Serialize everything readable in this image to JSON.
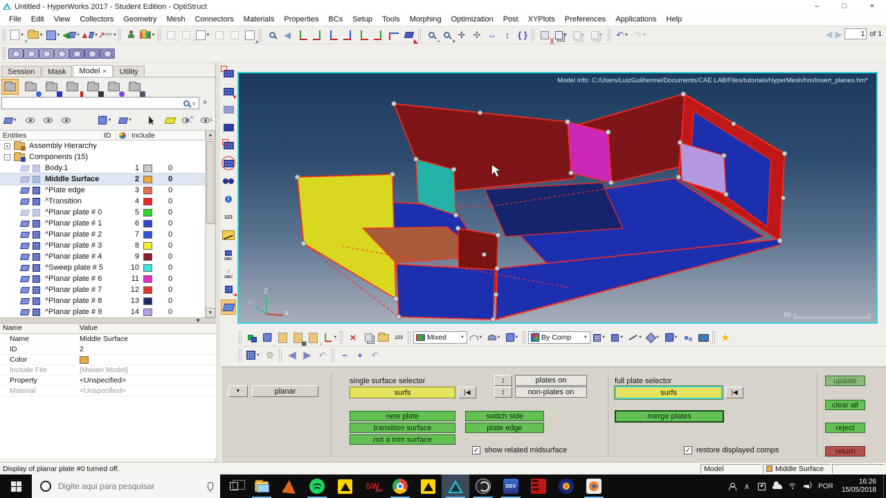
{
  "palette": {
    "accent_orange": "#f2a93b",
    "button_green": "#63c153",
    "button_green_disabled": "#8abb78",
    "button_yellow": "#e6e45e",
    "button_maroon": "#b5514b",
    "selector_active_border": "#35d0e0",
    "viewport_border": "#2cd3dc",
    "taskbar_active": "#3a4a58"
  },
  "icons": {
    "caret": "▼",
    "spinner": "↕",
    "reset": "|◀",
    "check": "✓",
    "chevrons": "»",
    "search_caret": "∨",
    "minimize": "–",
    "maximize": "□",
    "close": "×",
    "star": "★",
    "undo": "↶",
    "redo": "↷",
    "back": "◀",
    "forward": "▶",
    "minus": "−",
    "plus": "+",
    "braces": "{ }",
    "red_x": "×",
    "up_small": "▲",
    "down_small": "▼",
    "numbers": "123",
    "abc": "ABC",
    "hand": "✣",
    "arrows_h": "↔",
    "arrows_v": "↕",
    "dev": "DEV",
    "sw": "SW",
    "sw_year": "2017"
  },
  "title_bar": {
    "title": "Untitled - HyperWorks 2017 - Student Edition - OptiStruct"
  },
  "menu_bar": {
    "items": [
      "File",
      "Edit",
      "View",
      "Collectors",
      "Geometry",
      "Mesh",
      "Connectors",
      "Materials",
      "Properties",
      "BCs",
      "Setup",
      "Tools",
      "Morphing",
      "Optimization",
      "Post",
      "XYPlots",
      "Preferences",
      "Applications",
      "Help"
    ]
  },
  "toolbar": {
    "page_value": "1",
    "page_of_label": "of 1",
    "row1_icons": [
      "new-model",
      "open-model",
      "save-model",
      "import",
      "export",
      "export-ppt",
      "user",
      "results-folder",
      "add-page",
      "delete-page",
      "page-layout",
      "expand-page",
      "swap-page",
      "page-window",
      "zoom-tool",
      "back-view",
      "axis-yx",
      "axis-yx2",
      "axis-zx",
      "axis-zx2",
      "axis-zy",
      "axis-zy2",
      "axis-yz",
      "shaded-view",
      "zoom-out",
      "zoom-in",
      "center",
      "pan",
      "fit-width",
      "fit-height",
      "rotate",
      "cut",
      "copy",
      "paste",
      "paste-special",
      "undo",
      "redo"
    ],
    "row2_icons": [
      "capture-image",
      "capture-window",
      "capture-region",
      "capture-area",
      "capture-video",
      "capture-video-window",
      "capture-video-region"
    ]
  },
  "left_panel": {
    "tabs": [
      {
        "label": "Session"
      },
      {
        "label": "Mask"
      },
      {
        "label": "Model",
        "close": "×"
      },
      {
        "label": "Utility"
      }
    ],
    "browser_icons": [
      "model-view",
      "connection-view",
      "component-view",
      "include-view",
      "part-view",
      "set-view",
      "organize-view"
    ],
    "search_value": "",
    "tree": {
      "header": {
        "entities": "Entities",
        "id": "ID",
        "include": "Include"
      },
      "items": [
        {
          "expander": "+",
          "label": "Assembly Hierarchy"
        },
        {
          "expander": "-",
          "label": "Components (15)"
        },
        {
          "label": "Body.1",
          "id": "1",
          "color": "#c9c9c9",
          "include": "0",
          "dim": true
        },
        {
          "label": "Middle Surface",
          "id": "2",
          "color": "#f2a93b",
          "include": "0",
          "selected": true,
          "dim": true
        },
        {
          "label": "^Plate edge",
          "id": "3",
          "color": "#e2714c",
          "include": "0"
        },
        {
          "label": "^Transition",
          "id": "4",
          "color": "#ee2222",
          "include": "0"
        },
        {
          "label": "^Planar plate # 0",
          "id": "5",
          "color": "#2ad82a",
          "include": "0",
          "dim": true
        },
        {
          "label": "^Planar plate # 1",
          "id": "6",
          "color": "#2945cf",
          "include": "0"
        },
        {
          "label": "^Planar plate # 2",
          "id": "7",
          "color": "#2c55e2",
          "include": "0"
        },
        {
          "label": "^Planar plate # 3",
          "id": "8",
          "color": "#f0ee30",
          "include": "0"
        },
        {
          "label": "^Planar plate # 4",
          "id": "9",
          "color": "#8e1a2a",
          "include": "0"
        },
        {
          "label": "^Sweep plate # 5",
          "id": "10",
          "color": "#38e8e8",
          "include": "0"
        },
        {
          "label": "^Planar plate # 6",
          "id": "11",
          "color": "#e32cc9",
          "include": "0"
        },
        {
          "label": "^Planar plate # 7",
          "id": "12",
          "color": "#da382a",
          "include": "0"
        },
        {
          "label": "^Planar plate # 8",
          "id": "13",
          "color": "#1b2b68",
          "include": "0"
        },
        {
          "label": "^Planar plate # 9",
          "id": "14",
          "color": "#bb9cea",
          "include": "0"
        }
      ]
    },
    "properties": {
      "header": {
        "name": "Name",
        "value": "Value"
      },
      "color_swatch": "#f2a93b",
      "rows": [
        {
          "name": "Name",
          "value": "Middle Surface"
        },
        {
          "name": "ID",
          "value": "2"
        },
        {
          "name": "Color",
          "value": ""
        },
        {
          "name": "Include File",
          "value": "[Master Model]",
          "muted": true
        },
        {
          "name": "Property",
          "value": "<Unspecified>"
        },
        {
          "name": "Material",
          "value": "<Unspecified>",
          "muted": true
        }
      ]
    }
  },
  "vertical_toolbar": {
    "icons": [
      "panel-frame",
      "panel-arrow",
      "panels",
      "panels-dark",
      "panel-frame-2",
      "panel-circle",
      "binoculars-find",
      "info",
      "numbers-display",
      "measure-angle",
      "element-labels",
      "load-labels",
      "reorder-panels",
      "surface-edit-active"
    ]
  },
  "viewport": {
    "model_info": "Model Info: C:/Users/LuizGuilherme/Documents/CAE LAB/Files/tutorials/HyperMesh/hm/Insert_planes.hm*",
    "axis": {
      "x": "X",
      "y": "Y",
      "z": "Z"
    },
    "scale_label": "50"
  },
  "view_toolbar": {
    "mixed_label": "Mixed",
    "by_comp_label": "By Comp",
    "row1_icons": [
      "components",
      "component-blue",
      "card-edit",
      "card-image",
      "load-import",
      "systems",
      "delete",
      "layers",
      "organize",
      "renumber",
      "mixed-mode-dropdown",
      "wireframe",
      "shaded",
      "solid",
      "by-comp-dropdown",
      "mesh-wire",
      "mesh-shaded",
      "line-style",
      "feature",
      "layer-set",
      "checker",
      "monitor",
      "favorites-star"
    ],
    "row2_icons": [
      "grid-panel",
      "wrench-options",
      "previous",
      "next",
      "undo-view",
      "collapse",
      "expand",
      "undo-small"
    ]
  },
  "panel": {
    "mode_label": "planar",
    "single_selector_label": "single surface selector",
    "single_selector_value": "surfs",
    "full_selector_label": "full plate selector",
    "full_selector_value": "surfs",
    "plates_on_label": "plates on",
    "non_plates_on_label": "non-plates on",
    "buttons": {
      "new_plate": "new plate",
      "transition_surface": "transition surface",
      "not_a_trim_surface": "not a trim surface",
      "switch_side": "switch side",
      "plate_edge": "plate edge",
      "merge_plates": "merge plates",
      "update": "update",
      "clear_all": "clear all",
      "reject": "reject",
      "return": "return"
    },
    "checkboxes": [
      {
        "label": "show related midsurface",
        "checked": true
      },
      {
        "label": "restore displayed comps",
        "checked": true
      }
    ]
  },
  "status_bar": {
    "message": "Display of planar plate #0 turned off.",
    "page_label": "Model",
    "component_label": "Middle Surface",
    "component_color": "#f2a93b"
  },
  "taskbar": {
    "search_placeholder": "Digite aqui para pesquisar",
    "apps": [
      "task-view",
      "file-explorer",
      "matlab",
      "spotify",
      "altair-student",
      "solidworks",
      "chrome",
      "altair-connect",
      "hyperworks",
      "obs-studio",
      "dev-cpp",
      "video-editor",
      "avee-player",
      "media-player"
    ],
    "tray_icons": [
      "people",
      "chevron-up",
      "handwriting",
      "onedrive",
      "wifi",
      "volume",
      "language"
    ],
    "language": "POR",
    "time": "16:26",
    "date": "15/05/2018"
  }
}
